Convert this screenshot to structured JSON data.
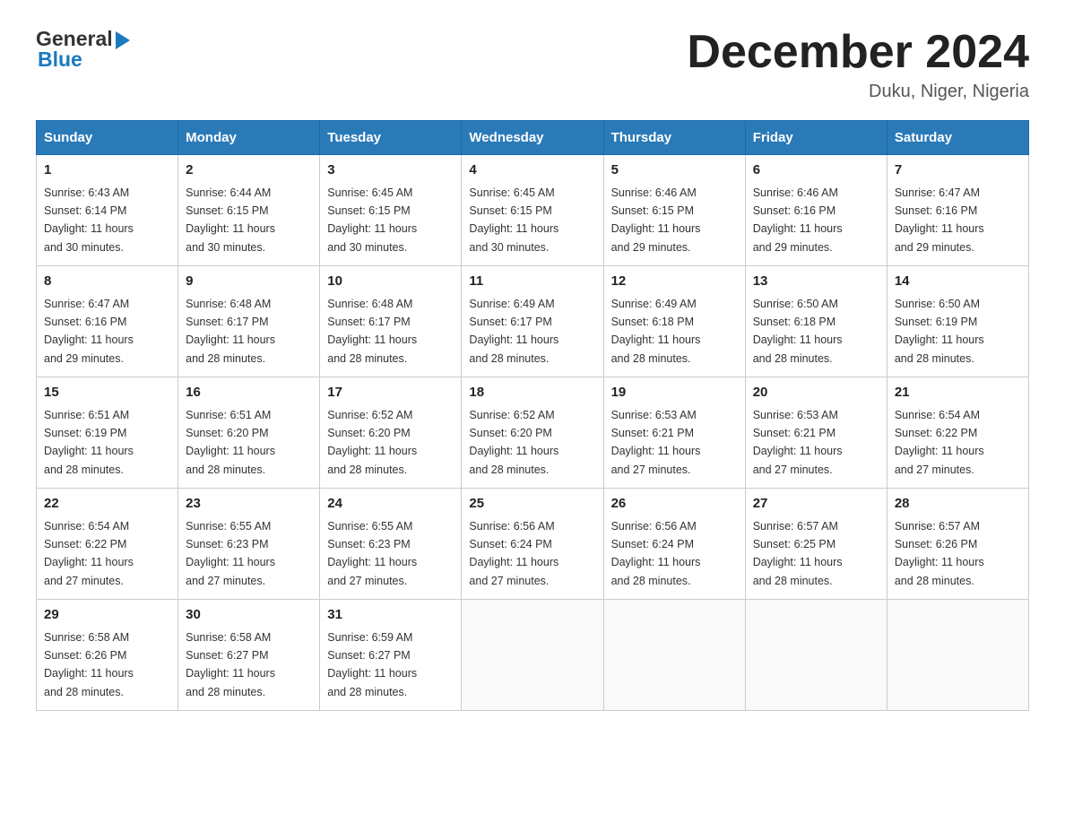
{
  "header": {
    "logo_general": "General",
    "logo_blue": "Blue",
    "month_title": "December 2024",
    "location": "Duku, Niger, Nigeria"
  },
  "calendar": {
    "days_of_week": [
      "Sunday",
      "Monday",
      "Tuesday",
      "Wednesday",
      "Thursday",
      "Friday",
      "Saturday"
    ],
    "weeks": [
      [
        {
          "day": "1",
          "sunrise": "6:43 AM",
          "sunset": "6:14 PM",
          "daylight": "11 hours and 30 minutes."
        },
        {
          "day": "2",
          "sunrise": "6:44 AM",
          "sunset": "6:15 PM",
          "daylight": "11 hours and 30 minutes."
        },
        {
          "day": "3",
          "sunrise": "6:45 AM",
          "sunset": "6:15 PM",
          "daylight": "11 hours and 30 minutes."
        },
        {
          "day": "4",
          "sunrise": "6:45 AM",
          "sunset": "6:15 PM",
          "daylight": "11 hours and 30 minutes."
        },
        {
          "day": "5",
          "sunrise": "6:46 AM",
          "sunset": "6:15 PM",
          "daylight": "11 hours and 29 minutes."
        },
        {
          "day": "6",
          "sunrise": "6:46 AM",
          "sunset": "6:16 PM",
          "daylight": "11 hours and 29 minutes."
        },
        {
          "day": "7",
          "sunrise": "6:47 AM",
          "sunset": "6:16 PM",
          "daylight": "11 hours and 29 minutes."
        }
      ],
      [
        {
          "day": "8",
          "sunrise": "6:47 AM",
          "sunset": "6:16 PM",
          "daylight": "11 hours and 29 minutes."
        },
        {
          "day": "9",
          "sunrise": "6:48 AM",
          "sunset": "6:17 PM",
          "daylight": "11 hours and 28 minutes."
        },
        {
          "day": "10",
          "sunrise": "6:48 AM",
          "sunset": "6:17 PM",
          "daylight": "11 hours and 28 minutes."
        },
        {
          "day": "11",
          "sunrise": "6:49 AM",
          "sunset": "6:17 PM",
          "daylight": "11 hours and 28 minutes."
        },
        {
          "day": "12",
          "sunrise": "6:49 AM",
          "sunset": "6:18 PM",
          "daylight": "11 hours and 28 minutes."
        },
        {
          "day": "13",
          "sunrise": "6:50 AM",
          "sunset": "6:18 PM",
          "daylight": "11 hours and 28 minutes."
        },
        {
          "day": "14",
          "sunrise": "6:50 AM",
          "sunset": "6:19 PM",
          "daylight": "11 hours and 28 minutes."
        }
      ],
      [
        {
          "day": "15",
          "sunrise": "6:51 AM",
          "sunset": "6:19 PM",
          "daylight": "11 hours and 28 minutes."
        },
        {
          "day": "16",
          "sunrise": "6:51 AM",
          "sunset": "6:20 PM",
          "daylight": "11 hours and 28 minutes."
        },
        {
          "day": "17",
          "sunrise": "6:52 AM",
          "sunset": "6:20 PM",
          "daylight": "11 hours and 28 minutes."
        },
        {
          "day": "18",
          "sunrise": "6:52 AM",
          "sunset": "6:20 PM",
          "daylight": "11 hours and 28 minutes."
        },
        {
          "day": "19",
          "sunrise": "6:53 AM",
          "sunset": "6:21 PM",
          "daylight": "11 hours and 27 minutes."
        },
        {
          "day": "20",
          "sunrise": "6:53 AM",
          "sunset": "6:21 PM",
          "daylight": "11 hours and 27 minutes."
        },
        {
          "day": "21",
          "sunrise": "6:54 AM",
          "sunset": "6:22 PM",
          "daylight": "11 hours and 27 minutes."
        }
      ],
      [
        {
          "day": "22",
          "sunrise": "6:54 AM",
          "sunset": "6:22 PM",
          "daylight": "11 hours and 27 minutes."
        },
        {
          "day": "23",
          "sunrise": "6:55 AM",
          "sunset": "6:23 PM",
          "daylight": "11 hours and 27 minutes."
        },
        {
          "day": "24",
          "sunrise": "6:55 AM",
          "sunset": "6:23 PM",
          "daylight": "11 hours and 27 minutes."
        },
        {
          "day": "25",
          "sunrise": "6:56 AM",
          "sunset": "6:24 PM",
          "daylight": "11 hours and 27 minutes."
        },
        {
          "day": "26",
          "sunrise": "6:56 AM",
          "sunset": "6:24 PM",
          "daylight": "11 hours and 28 minutes."
        },
        {
          "day": "27",
          "sunrise": "6:57 AM",
          "sunset": "6:25 PM",
          "daylight": "11 hours and 28 minutes."
        },
        {
          "day": "28",
          "sunrise": "6:57 AM",
          "sunset": "6:26 PM",
          "daylight": "11 hours and 28 minutes."
        }
      ],
      [
        {
          "day": "29",
          "sunrise": "6:58 AM",
          "sunset": "6:26 PM",
          "daylight": "11 hours and 28 minutes."
        },
        {
          "day": "30",
          "sunrise": "6:58 AM",
          "sunset": "6:27 PM",
          "daylight": "11 hours and 28 minutes."
        },
        {
          "day": "31",
          "sunrise": "6:59 AM",
          "sunset": "6:27 PM",
          "daylight": "11 hours and 28 minutes."
        },
        null,
        null,
        null,
        null
      ]
    ],
    "labels": {
      "sunrise": "Sunrise:",
      "sunset": "Sunset:",
      "daylight": "Daylight:"
    }
  }
}
